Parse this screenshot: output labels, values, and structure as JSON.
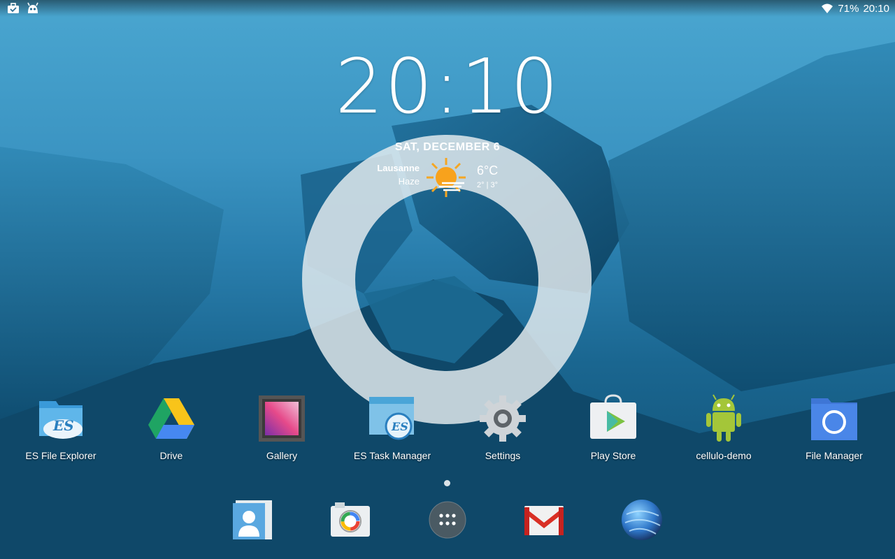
{
  "statusbar": {
    "left_icons": [
      "briefcase-check-icon",
      "cyanogen-bot-icon"
    ],
    "battery": "71%",
    "time": "20:10"
  },
  "clock": {
    "time": "20:10"
  },
  "weather": {
    "date": "SAT, DECEMBER 6",
    "city": "Lausanne",
    "condition": "Haze",
    "temperature": "6°C",
    "range": "2° | 3°",
    "icon": "sun-haze-icon"
  },
  "apps": [
    {
      "label": "ES File Explorer",
      "icon": "es-file-explorer-icon"
    },
    {
      "label": "Drive",
      "icon": "drive-icon"
    },
    {
      "label": "Gallery",
      "icon": "gallery-icon"
    },
    {
      "label": "ES Task Manager",
      "icon": "es-task-manager-icon"
    },
    {
      "label": "Settings",
      "icon": "settings-gear-icon"
    },
    {
      "label": "Play Store",
      "icon": "play-store-icon"
    },
    {
      "label": "cellulo-demo",
      "icon": "android-robot-icon"
    },
    {
      "label": "File Manager",
      "icon": "file-manager-icon"
    }
  ],
  "dock": [
    {
      "icon": "contacts-icon"
    },
    {
      "icon": "camera-icon"
    },
    {
      "icon": "app-drawer-icon"
    },
    {
      "icon": "gmail-icon"
    },
    {
      "icon": "browser-globe-icon"
    }
  ],
  "colors": {
    "accent_blue": "#2a7fae",
    "ring": "#e8eef0",
    "play_store_green": "#7cc243",
    "android_green": "#a4c639"
  }
}
